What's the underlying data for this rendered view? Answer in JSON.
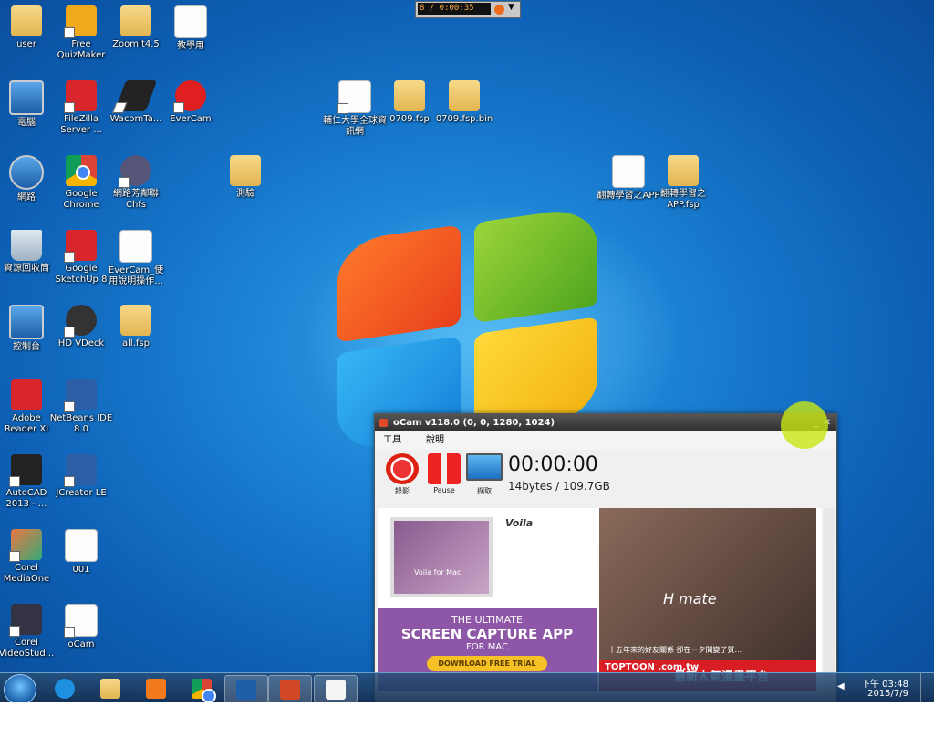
{
  "recorder": {
    "time": "8 / 0:00:35"
  },
  "desktop_icons": [
    {
      "label": "user",
      "kind": "folder"
    },
    {
      "label": "Free QuizMaker",
      "kind": "quiz"
    },
    {
      "label": "ZoomIt4.5",
      "kind": "folder"
    },
    {
      "label": "教學用",
      "kind": "doc"
    },
    {
      "label": "電腦",
      "kind": "monitor"
    },
    {
      "label": "FileZilla Server ...",
      "kind": "red"
    },
    {
      "label": "WacomTa...",
      "kind": "tablet"
    },
    {
      "label": "EverCam",
      "kind": "evercam"
    },
    {
      "label": "輔仁大學全球資訊網",
      "kind": "doc"
    },
    {
      "label": "0709.fsp",
      "kind": "folder"
    },
    {
      "label": "0709.fsp.bin",
      "kind": "folder"
    },
    {
      "label": "網路",
      "kind": "monitor"
    },
    {
      "label": "Google Chrome",
      "kind": "chrome"
    },
    {
      "label": "網路芳鄰聯Chfs",
      "kind": "folder"
    },
    {
      "label": "測驗",
      "kind": "folder"
    },
    {
      "label": "翻轉學習之APP",
      "kind": "doc"
    },
    {
      "label": "翻轉學習之APP.fsp",
      "kind": "folder"
    },
    {
      "label": "資源回收筒",
      "kind": "bin"
    },
    {
      "label": "Google SketchUp 8",
      "kind": "red"
    },
    {
      "label": "EverCam_使用說明操作...",
      "kind": "doc"
    },
    {
      "label": "控制台",
      "kind": "monitor"
    },
    {
      "label": "HD VDeck",
      "kind": "dark"
    },
    {
      "label": "all.fsp",
      "kind": "folder"
    },
    {
      "label": "Adobe Reader XI",
      "kind": "red"
    },
    {
      "label": "NetBeans IDE 8.0",
      "kind": "blue"
    },
    {
      "label": "AutoCAD 2013 - ...",
      "kind": "red"
    },
    {
      "label": "JCreator LE",
      "kind": "blue"
    },
    {
      "label": "Corel MediaOne",
      "kind": "monitor"
    },
    {
      "label": "001",
      "kind": "doc"
    },
    {
      "label": "Corel VideoStud...",
      "kind": "dark"
    },
    {
      "label": "oCam",
      "kind": "doc"
    }
  ],
  "ocam": {
    "title": "oCam v118.0 (0, 0, 1280, 1024)",
    "min": "_",
    "close": "✕",
    "menu": [
      "工具",
      "說明"
    ],
    "tools": {
      "record": "錄影",
      "pause": "Pause",
      "capture": "擷取"
    },
    "time": "00:00:00",
    "size": "14bytes / 109.7GB"
  },
  "ad1": {
    "brand": "Voila",
    "screen_text": "Voila for Mac",
    "line1": "THE ULTIMATE",
    "line2": "SCREEN CAPTURE APP",
    "line3": "FOR MAC",
    "button": "DOWNLOAD FREE TRIAL"
  },
  "ad2": {
    "title": "H mate",
    "caption": "十五年來的好友關係 卻在一夕間變了質...",
    "brand": "TOPTOON .com.tw",
    "slogan": "最新人氣漫畫平台"
  },
  "clock": {
    "time": "下午 03:48",
    "date": "2015/7/9"
  }
}
